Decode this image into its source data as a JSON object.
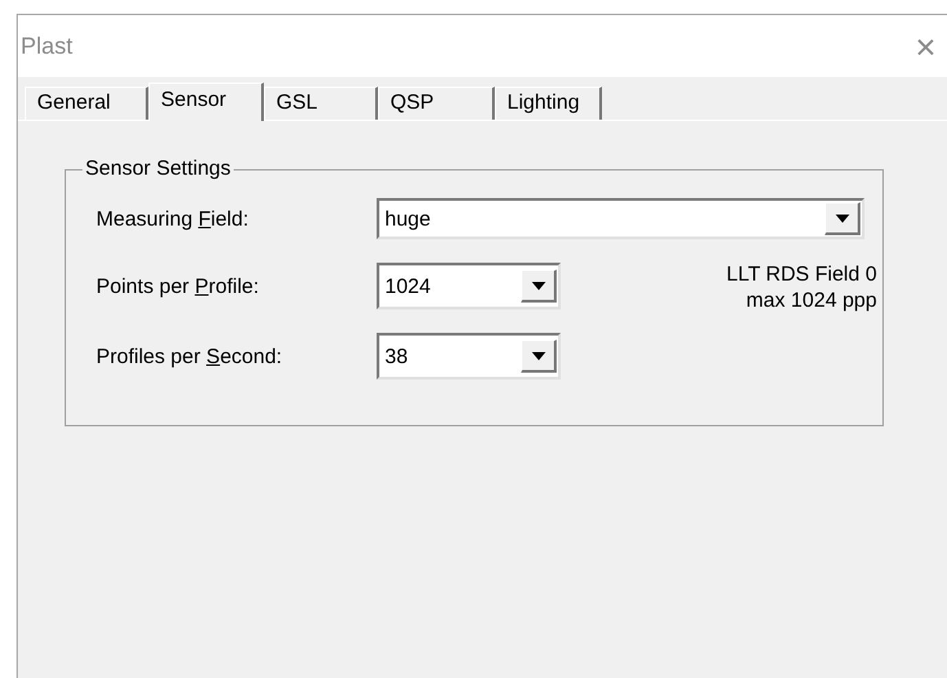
{
  "window": {
    "title": "Plast",
    "close": "×"
  },
  "tabs": [
    {
      "label": "General",
      "selected": false
    },
    {
      "label": "Sensor",
      "selected": true
    },
    {
      "label": "GSL",
      "selected": false
    },
    {
      "label": "QSP",
      "selected": false
    },
    {
      "label": "Lighting",
      "selected": false
    }
  ],
  "group": {
    "title": "Sensor Settings",
    "fields": [
      {
        "label_before": "Measuring ",
        "access_key": "F",
        "label_after": "ield:",
        "value": "huge",
        "kind": "wide"
      },
      {
        "label_before": "Points per ",
        "access_key": "P",
        "label_after": "rofile:",
        "value": "1024",
        "kind": "narrow"
      },
      {
        "label_before": "Profiles per ",
        "access_key": "S",
        "label_after": "econd:",
        "value": "38",
        "kind": "narrow"
      }
    ],
    "info": [
      "LLT RDS Field 0",
      "max 1024 ppp"
    ]
  }
}
